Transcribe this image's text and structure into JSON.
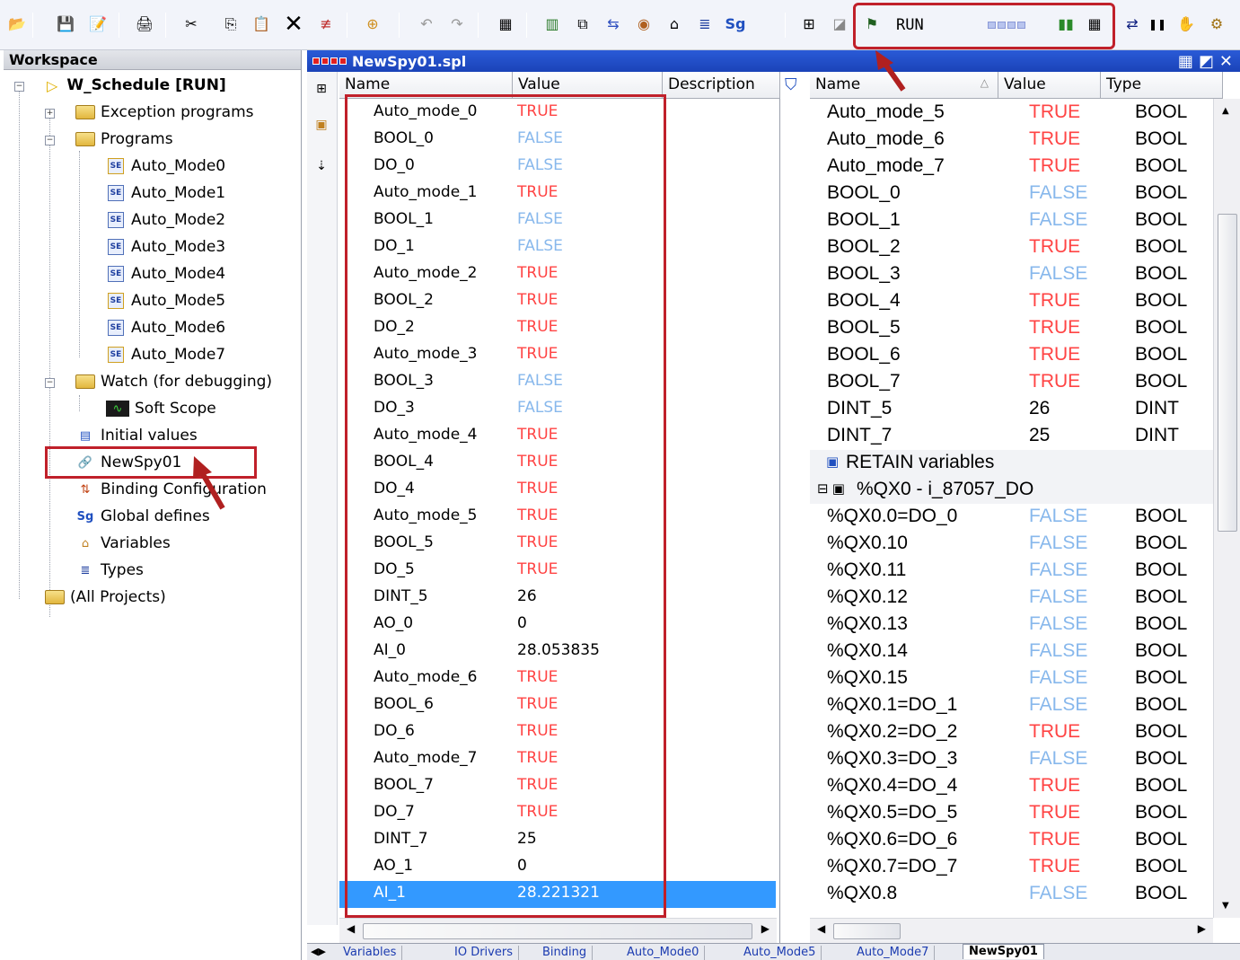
{
  "toolbar": {
    "run_label": "RUN",
    "icons": [
      "open-icon",
      "save-icon",
      "edit-icon",
      "print-icon",
      "cut-icon",
      "copy-icon",
      "paste-icon",
      "delete-icon",
      "clear-icon",
      "insert-icon",
      "undo-icon",
      "redo-icon",
      "build-icon",
      "grid-icon",
      "network-icon",
      "binding-icon",
      "io-icon",
      "home-icon",
      "types-icon",
      "defines-icon",
      "window-icon",
      "monitor-icon",
      "debug-icon",
      "stop-icon",
      "pause-icon",
      "step-icon",
      "settings-icon"
    ]
  },
  "workspace": {
    "title": "Workspace",
    "project": "W_Schedule [RUN]",
    "nodes": {
      "exception": "Exception programs",
      "programs": "Programs",
      "p0": "Auto_Mode0",
      "p1": "Auto_Mode1",
      "p2": "Auto_Mode2",
      "p3": "Auto_Mode3",
      "p4": "Auto_Mode4",
      "p5": "Auto_Mode5",
      "p6": "Auto_Mode6",
      "p7": "Auto_Mode7",
      "watch": "Watch (for debugging)",
      "scope": "Soft Scope",
      "initial": "Initial values",
      "spy": "NewSpy01",
      "binding": "Binding Configuration",
      "defines": "Global defines",
      "variables": "Variables",
      "types": "Types",
      "all": "(All Projects)"
    }
  },
  "spy": {
    "title": "NewSpy01.spl",
    "left_headers": {
      "name": "Name",
      "value": "Value",
      "description": "Description"
    },
    "left_rows": [
      {
        "name": "Auto_mode_0",
        "value": "TRUE"
      },
      {
        "name": "BOOL_0",
        "value": "FALSE"
      },
      {
        "name": "DO_0",
        "value": "FALSE"
      },
      {
        "name": "Auto_mode_1",
        "value": "TRUE"
      },
      {
        "name": "BOOL_1",
        "value": "FALSE"
      },
      {
        "name": "DO_1",
        "value": "FALSE"
      },
      {
        "name": "Auto_mode_2",
        "value": "TRUE"
      },
      {
        "name": "BOOL_2",
        "value": "TRUE"
      },
      {
        "name": "DO_2",
        "value": "TRUE"
      },
      {
        "name": "Auto_mode_3",
        "value": "TRUE"
      },
      {
        "name": "BOOL_3",
        "value": "FALSE"
      },
      {
        "name": "DO_3",
        "value": "FALSE"
      },
      {
        "name": "Auto_mode_4",
        "value": "TRUE"
      },
      {
        "name": "BOOL_4",
        "value": "TRUE"
      },
      {
        "name": "DO_4",
        "value": "TRUE"
      },
      {
        "name": "Auto_mode_5",
        "value": "TRUE"
      },
      {
        "name": "BOOL_5",
        "value": "TRUE"
      },
      {
        "name": "DO_5",
        "value": "TRUE"
      },
      {
        "name": "DINT_5",
        "value": "26"
      },
      {
        "name": "AO_0",
        "value": "0"
      },
      {
        "name": "AI_0",
        "value": "28.053835"
      },
      {
        "name": "Auto_mode_6",
        "value": "TRUE"
      },
      {
        "name": "BOOL_6",
        "value": "TRUE"
      },
      {
        "name": "DO_6",
        "value": "TRUE"
      },
      {
        "name": "Auto_mode_7",
        "value": "TRUE"
      },
      {
        "name": "BOOL_7",
        "value": "TRUE"
      },
      {
        "name": "DO_7",
        "value": "TRUE"
      },
      {
        "name": "DINT_7",
        "value": "25"
      },
      {
        "name": "AO_1",
        "value": "0"
      },
      {
        "name": "AI_1",
        "value": "28.221321"
      }
    ],
    "right_headers": {
      "name": "Name",
      "value": "Value",
      "type": "Type"
    },
    "right_rows": [
      {
        "name": "Auto_mode_5",
        "value": "TRUE",
        "type": "BOOL"
      },
      {
        "name": "Auto_mode_6",
        "value": "TRUE",
        "type": "BOOL"
      },
      {
        "name": "Auto_mode_7",
        "value": "TRUE",
        "type": "BOOL"
      },
      {
        "name": "BOOL_0",
        "value": "FALSE",
        "type": "BOOL"
      },
      {
        "name": "BOOL_1",
        "value": "FALSE",
        "type": "BOOL"
      },
      {
        "name": "BOOL_2",
        "value": "TRUE",
        "type": "BOOL"
      },
      {
        "name": "BOOL_3",
        "value": "FALSE",
        "type": "BOOL"
      },
      {
        "name": "BOOL_4",
        "value": "TRUE",
        "type": "BOOL"
      },
      {
        "name": "BOOL_5",
        "value": "TRUE",
        "type": "BOOL"
      },
      {
        "name": "BOOL_6",
        "value": "TRUE",
        "type": "BOOL"
      },
      {
        "name": "BOOL_7",
        "value": "TRUE",
        "type": "BOOL"
      },
      {
        "name": "DINT_5",
        "value": "26",
        "type": "DINT"
      },
      {
        "name": "DINT_7",
        "value": "25",
        "type": "DINT"
      },
      {
        "name": "RETAIN variables",
        "value": "",
        "type": "",
        "group": "retain"
      },
      {
        "name": "%QX0 - i_87057_DO",
        "value": "",
        "type": "",
        "group": "io"
      },
      {
        "name": "%QX0.0=DO_0",
        "value": "FALSE",
        "type": "BOOL"
      },
      {
        "name": "%QX0.10",
        "value": "FALSE",
        "type": "BOOL"
      },
      {
        "name": "%QX0.11",
        "value": "FALSE",
        "type": "BOOL"
      },
      {
        "name": "%QX0.12",
        "value": "FALSE",
        "type": "BOOL"
      },
      {
        "name": "%QX0.13",
        "value": "FALSE",
        "type": "BOOL"
      },
      {
        "name": "%QX0.14",
        "value": "FALSE",
        "type": "BOOL"
      },
      {
        "name": "%QX0.15",
        "value": "FALSE",
        "type": "BOOL"
      },
      {
        "name": "%QX0.1=DO_1",
        "value": "FALSE",
        "type": "BOOL"
      },
      {
        "name": "%QX0.2=DO_2",
        "value": "TRUE",
        "type": "BOOL"
      },
      {
        "name": "%QX0.3=DO_3",
        "value": "FALSE",
        "type": "BOOL"
      },
      {
        "name": "%QX0.4=DO_4",
        "value": "TRUE",
        "type": "BOOL"
      },
      {
        "name": "%QX0.5=DO_5",
        "value": "TRUE",
        "type": "BOOL"
      },
      {
        "name": "%QX0.6=DO_6",
        "value": "TRUE",
        "type": "BOOL"
      },
      {
        "name": "%QX0.7=DO_7",
        "value": "TRUE",
        "type": "BOOL"
      },
      {
        "name": "%QX0.8",
        "value": "FALSE",
        "type": "BOOL"
      }
    ]
  },
  "tabs": [
    "Variables",
    "IO Drivers",
    "Binding",
    "Auto_Mode0",
    "Auto_Mode5",
    "Auto_Mode7",
    "NewSpy01"
  ],
  "colors": {
    "true_value": "#ff4444",
    "false_value": "#88b8ec",
    "highlight_box": "#c0202a",
    "title_bar": "#2a5bd7",
    "selected_row": "#3399ff"
  }
}
